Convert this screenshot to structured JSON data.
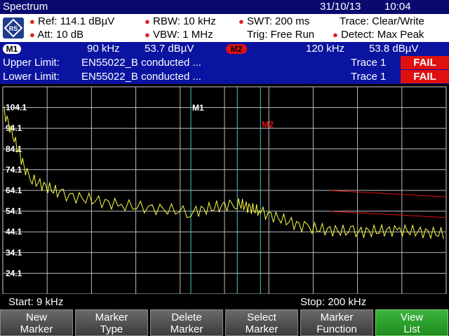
{
  "window": {
    "title": "Spectrum",
    "date": "31/10/13",
    "time": "10:04"
  },
  "params": {
    "ref": "Ref:  114.1 dBµV",
    "att": "Att:  10 dB",
    "rbw": "RBW:  10 kHz",
    "vbw": "VBW:  1 MHz",
    "swt": "SWT:   200 ms",
    "trig": "Trig:    Free Run",
    "trace": "Trace:   Clear/Write",
    "detect": "Detect:  Max Peak"
  },
  "markers": {
    "m1": {
      "label": "M1",
      "freq": "90  kHz",
      "level": "53.7  dBµV"
    },
    "m2": {
      "label": "M2",
      "freq": "120  kHz",
      "level": "53.8  dBµV"
    }
  },
  "limits": {
    "upper": {
      "label": "Upper Limit:",
      "name": "EN55022_B conducted ...",
      "trace": "Trace 1",
      "status": "FAIL"
    },
    "lower": {
      "label": "Lower Limit:",
      "name": "EN55022_B conducted ...",
      "trace": "Trace 1",
      "status": "FAIL"
    }
  },
  "axis": {
    "ylabels": [
      "104.1",
      "94.1",
      "84.1",
      "74.1",
      "64.1",
      "54.1",
      "44.1",
      "34.1",
      "24.1"
    ],
    "start": "Start:  9 kHz",
    "stop": "Stop: 200 kHz"
  },
  "chart_data": {
    "type": "line",
    "ylim": [
      14.1,
      114.1
    ],
    "xlim": [
      9,
      200
    ],
    "grid": true,
    "series": [
      {
        "x": [
          9,
          20,
          35,
          60,
          90,
          110,
          120,
          140,
          160,
          180,
          200
        ],
        "y": [
          104,
          70,
          62,
          57,
          53.7,
          58,
          53.8,
          46,
          44,
          45,
          43
        ]
      }
    ],
    "upper_limit": {
      "x": [
        150,
        200
      ],
      "y": [
        64,
        61
      ]
    },
    "lower_limit": {
      "x": [
        150,
        200
      ],
      "y": [
        54,
        51
      ]
    }
  },
  "softkeys": [
    {
      "line1": "New",
      "line2": "Marker"
    },
    {
      "line1": "Marker",
      "line2": "Type"
    },
    {
      "line1": "Delete",
      "line2": "Marker"
    },
    {
      "line1": "Select",
      "line2": "Marker"
    },
    {
      "line1": "Marker",
      "line2": "Function"
    },
    {
      "line1": "View",
      "line2": "List"
    }
  ],
  "colors": {
    "trace": "#ffff44",
    "fail_trace": "#e01010",
    "marker_line": "#3ccccc",
    "fail": "#e01010"
  }
}
